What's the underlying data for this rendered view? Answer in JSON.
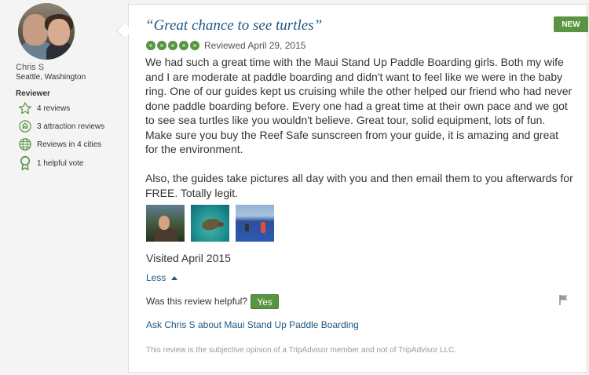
{
  "member": {
    "name": "Chris S",
    "location": "Seattle, Washington",
    "role_label": "Reviewer",
    "badges": [
      {
        "icon": "star-outline-icon",
        "label": "4 reviews"
      },
      {
        "icon": "attraction-icon",
        "label": "3 attraction reviews"
      },
      {
        "icon": "globe-icon",
        "label": "Reviews in 4 cities"
      },
      {
        "icon": "ribbon-icon",
        "label": "1 helpful vote"
      }
    ]
  },
  "review": {
    "badge": "NEW",
    "title": "“Great chance to see turtles”",
    "rating": 5,
    "rating_max": 5,
    "date": "Reviewed April 29, 2015",
    "paragraphs": [
      "We had such a great time with the Maui Stand Up Paddle Boarding girls. Both my wife and I are moderate at paddle boarding and didn't want to feel like we were in the baby ring. One of our guides kept us cruising while the other helped our friend who had never done paddle boarding before. Every one had a great time at their own pace and we got to see sea turtles like you wouldn't believe. Great tour, solid equipment, lots of fun. Make sure you buy the Reef Safe sunscreen from your guide, it is amazing and great for the environment.",
      "Also, the guides take pictures all day with you and then email them to you afterwards for FREE. Totally legit."
    ],
    "visited": "Visited April 2015",
    "less_label": "Less",
    "helpful_question": "Was this review helpful?",
    "yes_label": "Yes",
    "ask_link": "Ask Chris S about Maui Stand Up Paddle Boarding",
    "disclaimer": "This review is the subjective opinion of a TripAdvisor member and not of TripAdvisor LLC."
  },
  "colors": {
    "accent_green": "#589442",
    "link_blue": "#1f5783"
  }
}
